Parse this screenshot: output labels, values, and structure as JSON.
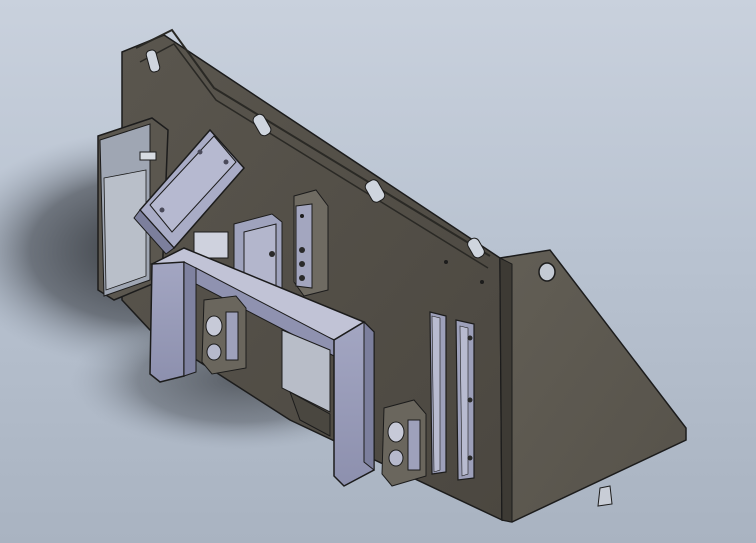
{
  "scene": {
    "subject": "steel-bracket-assembly",
    "colors": {
      "background_top": "#c9d1dd",
      "background_bottom": "#a9b3c1",
      "steel_dark": "#4e4a42",
      "steel_mid": "#5a564e",
      "steel_light": "#6a665d",
      "part_blue_light": "#b4b6cf",
      "part_blue_mid": "#9c9fba",
      "part_blue_dark": "#7f82a0",
      "outline": "#1c1c1c",
      "shadow": "#2e3135"
    }
  }
}
